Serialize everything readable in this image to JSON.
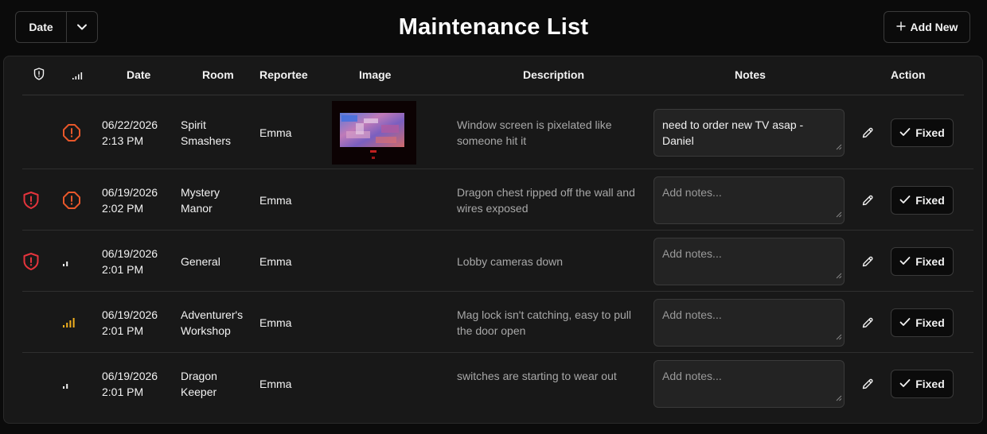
{
  "header": {
    "title": "Maintenance List",
    "sort_label": "Date",
    "add_label": "Add New"
  },
  "table": {
    "columns": [
      "",
      "",
      "Date",
      "Room",
      "Reportee",
      "Image",
      "Description",
      "Notes",
      "Action"
    ],
    "column_icons": [
      "shield-icon",
      "signal-icon"
    ],
    "notes_placeholder": "Add notes...",
    "fixed_label": "Fixed",
    "rows": [
      {
        "flagged": false,
        "priority": "urgent",
        "date": "06/22/2026",
        "time": "2:13 PM",
        "room": [
          "Spirit",
          "Smashers"
        ],
        "reportee": "Emma",
        "has_image": true,
        "description": "Window screen is pixelated like someone hit it",
        "notes": "need to order new TV asap - Daniel"
      },
      {
        "flagged": true,
        "priority": "urgent",
        "date": "06/19/2026",
        "time": "2:02 PM",
        "room": [
          "Mystery",
          "Manor"
        ],
        "reportee": "Emma",
        "has_image": false,
        "description": "Dragon chest ripped off the wall and wires exposed",
        "notes": ""
      },
      {
        "flagged": true,
        "priority": "low",
        "date": "06/19/2026",
        "time": "2:01 PM",
        "room": [
          "General"
        ],
        "reportee": "Emma",
        "has_image": false,
        "description": "Lobby cameras down",
        "notes": ""
      },
      {
        "flagged": false,
        "priority": "high",
        "date": "06/19/2026",
        "time": "2:01 PM",
        "room": [
          "Adventurer's",
          "Workshop"
        ],
        "reportee": "Emma",
        "has_image": false,
        "description": "Mag lock isn't catching, easy to pull the door open",
        "notes": ""
      },
      {
        "flagged": false,
        "priority": "low",
        "date": "06/19/2026",
        "time": "2:01 PM",
        "room": [
          "Dragon",
          "Keeper"
        ],
        "reportee": "Emma",
        "has_image": false,
        "description": "switches are starting to wear out",
        "notes": ""
      }
    ]
  },
  "colors": {
    "urgent": "#e8572a",
    "flag": "#e5343c",
    "high": "#f2b01e",
    "neutral": "#f2f2f2"
  }
}
